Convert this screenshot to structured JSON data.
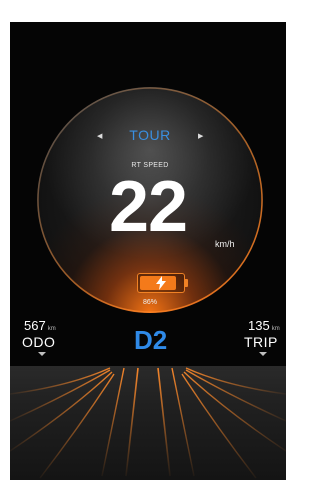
{
  "dashboard": {
    "mode": "TOUR",
    "speed_label": "RT SPEED",
    "speed": "22",
    "speed_unit": "km/h",
    "battery_percent_text": "86%",
    "battery_level": 0.86,
    "gear": "D2",
    "odo": {
      "value": "567",
      "unit": "km",
      "label": "ODO"
    },
    "trip": {
      "value": "135",
      "unit": "km",
      "label": "TRIP"
    }
  },
  "icons": {
    "mode_prev": "triangle-left-icon",
    "mode_next": "triangle-right-icon",
    "battery": "battery-icon",
    "charging": "lightning-bolt-icon"
  },
  "colors": {
    "accent_blue": "#2f8ae8",
    "accent_orange": "#f47a1a",
    "background": "#050505"
  }
}
